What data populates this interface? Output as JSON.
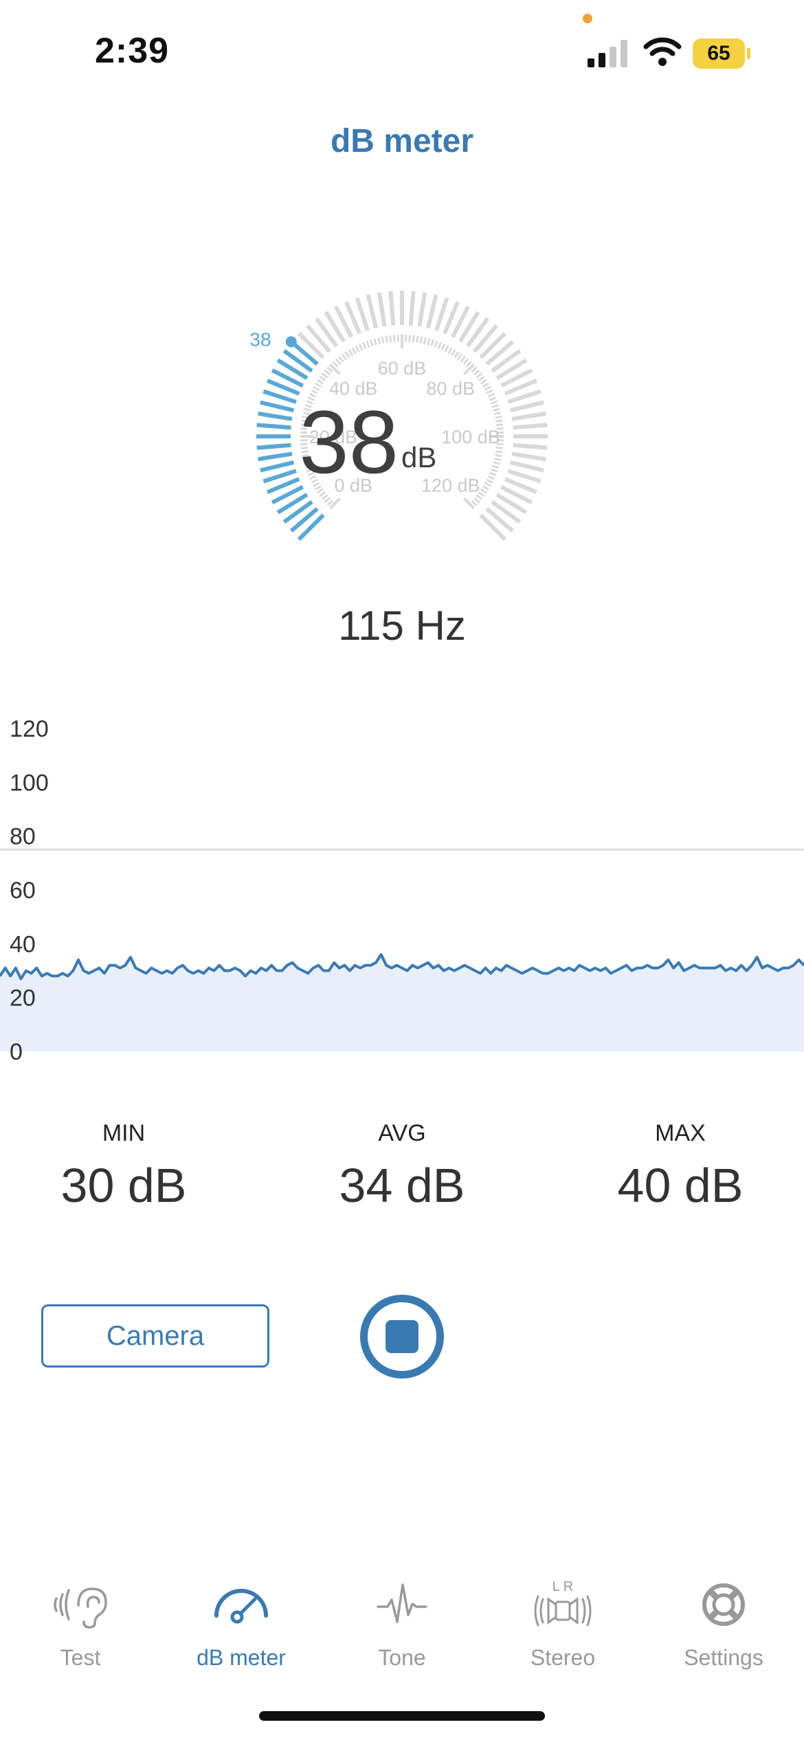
{
  "status_bar": {
    "time": "2:39",
    "battery": "65"
  },
  "header": {
    "title": "dB meter"
  },
  "gauge": {
    "current_value": "38",
    "current_number": 38,
    "unit": "dB",
    "pointer_label": "38",
    "min": 0,
    "max": 120,
    "scale_labels": [
      "0 dB",
      "20 dB",
      "40 dB",
      "60 dB",
      "80 dB",
      "100 dB",
      "120 dB"
    ],
    "active_color": "#5aa8d6",
    "inactive_color": "#d9d9d9"
  },
  "frequency": "115 Hz",
  "chart_data": {
    "type": "area",
    "y_ticks": [
      "120",
      "100",
      "80",
      "60",
      "40",
      "20",
      "0"
    ],
    "ylim": [
      0,
      120
    ],
    "reference_line": 75,
    "values": [
      28,
      31,
      28,
      31,
      27,
      30,
      29,
      31,
      28,
      29,
      28,
      28,
      29,
      28,
      30,
      34,
      30,
      29,
      30,
      31,
      29,
      32,
      32,
      31,
      32,
      35,
      31,
      30,
      29,
      31,
      30,
      29,
      30,
      29,
      31,
      32,
      30,
      29,
      30,
      29,
      31,
      30,
      32,
      30,
      30,
      31,
      30,
      28,
      30,
      29,
      31,
      30,
      32,
      30,
      30,
      32,
      33,
      31,
      30,
      29,
      31,
      32,
      30,
      30,
      33,
      31,
      32,
      30,
      32,
      31,
      32,
      32,
      33,
      36,
      32,
      31,
      32,
      31,
      30,
      32,
      31,
      32,
      33,
      31,
      32,
      30,
      31,
      30,
      31,
      32,
      31,
      30,
      29,
      31,
      29,
      31,
      30,
      32,
      31,
      30,
      29,
      30,
      31,
      30,
      29,
      29,
      30,
      31,
      30,
      31,
      30,
      32,
      31,
      30,
      31,
      30,
      31,
      29,
      30,
      31,
      32,
      30,
      31,
      31,
      32,
      31,
      31,
      32,
      34,
      31,
      33,
      30,
      31,
      32,
      31,
      31,
      31,
      31,
      32,
      30,
      31,
      30,
      32,
      30,
      32,
      35,
      31,
      32,
      31,
      30,
      31,
      31,
      32,
      34,
      32
    ],
    "line_color": "#3a7ab3",
    "fill_color": "#e8eff8"
  },
  "stats": {
    "min": {
      "label": "MIN",
      "value": "30 dB"
    },
    "avg": {
      "label": "AVG",
      "value": "34 dB"
    },
    "max": {
      "label": "MAX",
      "value": "40 dB"
    }
  },
  "controls": {
    "camera_label": "Camera"
  },
  "tabs": [
    {
      "label": "Test",
      "icon": "hearing-test-icon",
      "active": false
    },
    {
      "label": "dB meter",
      "icon": "speedometer-icon",
      "active": true
    },
    {
      "label": "Tone",
      "icon": "waveform-icon",
      "active": false
    },
    {
      "label": "Stereo",
      "icon": "stereo-speaker-icon",
      "active": false
    },
    {
      "label": "Settings",
      "icon": "lifebuoy-icon",
      "active": false
    }
  ]
}
